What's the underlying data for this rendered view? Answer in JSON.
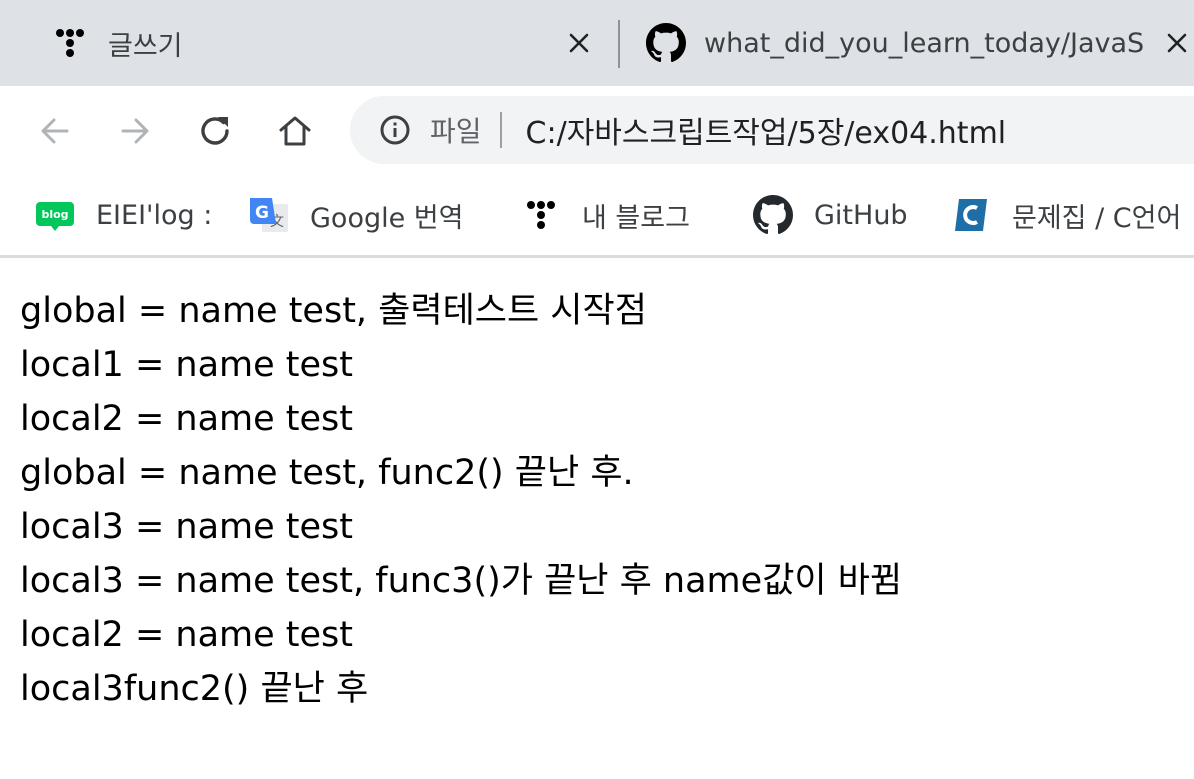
{
  "tabs": [
    {
      "title": "글쓰기",
      "favicon": "tistory-dots-icon"
    },
    {
      "title": "what_did_you_learn_today/JavaScript",
      "favicon": "github-icon"
    }
  ],
  "address_bar": {
    "security_label": "파일",
    "url": "C:/자바스크립트작업/5장/ex04.html"
  },
  "bookmarks": [
    {
      "label": "EIEI'log :",
      "icon": "naver-blog-icon",
      "color": "#03c75a"
    },
    {
      "label": "Google 번역",
      "icon": "google-translate-icon",
      "color": "#4285f4"
    },
    {
      "label": "내 블로그",
      "icon": "tistory-dots-icon",
      "color": "#000000"
    },
    {
      "label": "GitHub",
      "icon": "github-icon",
      "color": "#24292e"
    },
    {
      "label": "문제집 / C언어",
      "icon": "codeup-icon",
      "color": "#1e6fa8"
    }
  ],
  "page": {
    "lines": [
      "global = name test, 출력테스트 시작점",
      "local1 = name test",
      "local2 = name test",
      "global = name test, func2() 끝난 후.",
      "local3 = name test",
      "local3 = name test, func3()가 끝난 후 name값이 바뀜",
      "local2 = name test",
      "local3func2() 끝난 후"
    ]
  }
}
